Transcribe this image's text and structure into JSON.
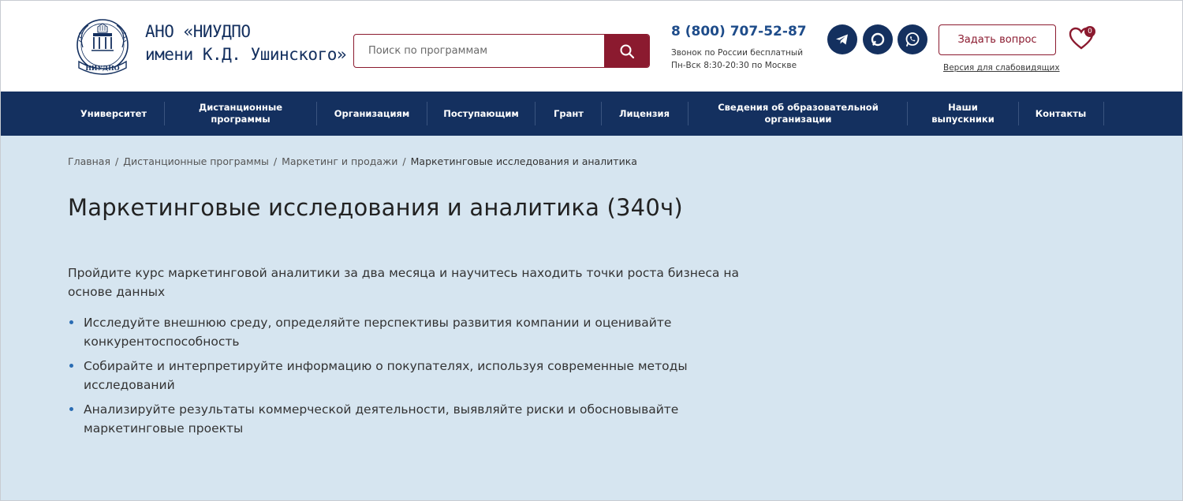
{
  "header": {
    "logo_alt": "НИУДПО",
    "org_line1": "АНО «НИУДПО",
    "org_line2": "имени К.Д. Ушинского»",
    "search": {
      "placeholder": "Поиск по программам",
      "value": ""
    },
    "phone": "8 (800) 707-52-87",
    "phone_note_line1": "Звонок по России бесплатный",
    "phone_note_line2": "Пн-Вск 8:30-20:30 по Москве",
    "social": [
      "telegram-icon",
      "max-messenger-icon",
      "whatsapp-icon"
    ],
    "ask_button": "Задать вопрос",
    "accessibility_link": "Версия для слабовидящих",
    "favorites_count": "0",
    "colors": {
      "primary": "#14305f",
      "accent": "#8b1a2f",
      "link_blue": "#1e4c8a"
    }
  },
  "nav": {
    "items": [
      {
        "label": "Университет"
      },
      {
        "label": "Дистанционные программы"
      },
      {
        "label": "Организациям"
      },
      {
        "label": "Поступающим"
      },
      {
        "label": "Грант"
      },
      {
        "label": "Лицензия"
      },
      {
        "label": "Сведения об образовательной организации"
      },
      {
        "label": "Наши выпускники"
      },
      {
        "label": "Контакты"
      }
    ]
  },
  "breadcrumb": {
    "items": [
      "Главная",
      "Дистанционные программы",
      "Маркетинг и продажи"
    ],
    "current": "Маркетинговые исследования и аналитика",
    "separator": "/"
  },
  "main": {
    "title": "Маркетинговые исследования и аналитика (340ч)",
    "intro": "Пройдите курс маркетинговой аналитики за два месяца и научитесь находить точки роста бизнеса на основе данных",
    "features": [
      "Исследуйте внешнюю среду, определяйте перспективы развития компании и оценивайте конкурентоспособность",
      "Собирайте и интерпретируйте информацию о покупателях, используя современные методы исследований",
      "Анализируйте результаты коммерческой деятельности, выявляйте риски и обосновывайте маркетинговые проекты"
    ]
  }
}
